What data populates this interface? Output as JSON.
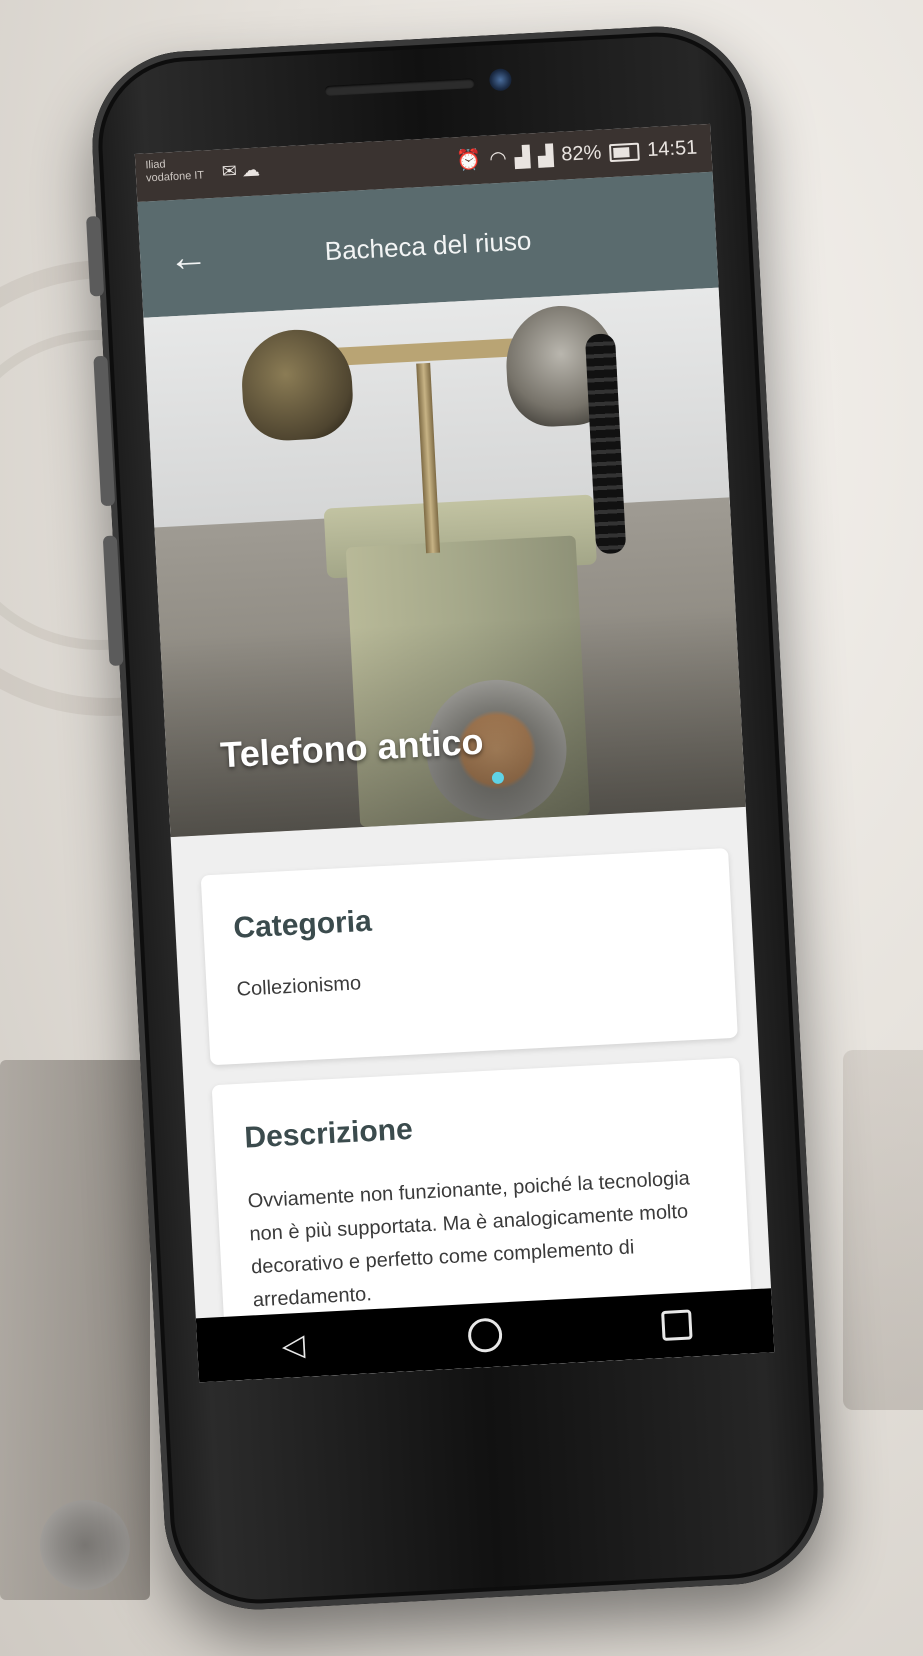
{
  "status_bar": {
    "carrier_primary": "Iliad",
    "carrier_secondary": "vodafone IT",
    "notification_icons": [
      "mail-icon",
      "cloud-icon"
    ],
    "right_icons": [
      "alarm-icon",
      "wifi-icon",
      "signal-icon",
      "signal-icon"
    ],
    "battery": "82%",
    "time": "14:51"
  },
  "app_bar": {
    "back_icon": "arrow-left-icon",
    "title": "Bacheca del riuso"
  },
  "hero": {
    "title": "Telefono antico",
    "indicator_color": "#5fd3e6"
  },
  "cards": {
    "category": {
      "title": "Categoria",
      "value": "Collezionismo"
    },
    "description": {
      "title": "Descrizione",
      "text": "Ovviamente non funzionante, poiché la tecnologia non è più supportata. Ma è analogicamente molto decorativo e perfetto come complemento di arredamento."
    }
  },
  "nav_bar": {
    "back": "◁",
    "home_icon": "circle-home-icon",
    "recents_icon": "square-recents-icon"
  },
  "colors": {
    "app_bar": "#5a6b6e",
    "status_bar": "#3a3330",
    "card_title": "#3b4b4d"
  }
}
